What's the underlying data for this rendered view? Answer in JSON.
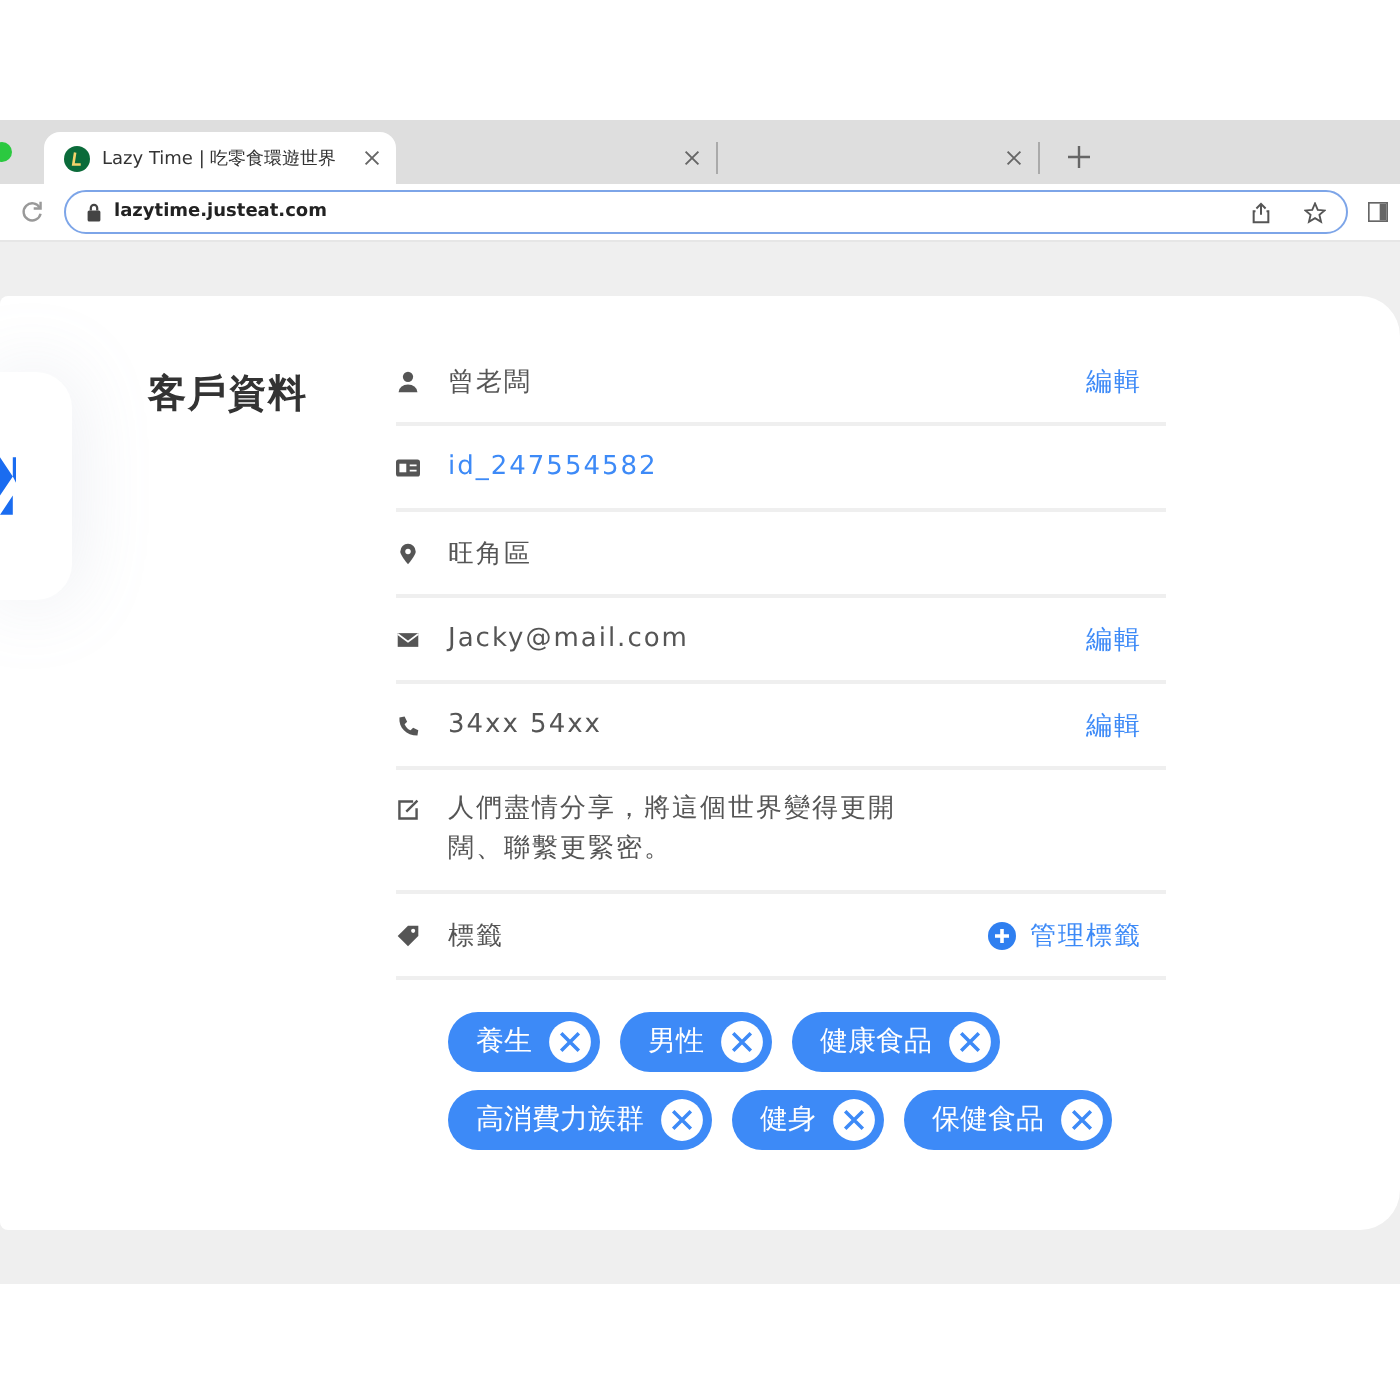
{
  "browser": {
    "tabs": [
      {
        "title": "Lazy Time | 吃零食環遊世界",
        "selected": true
      },
      {
        "selected": false
      },
      {
        "selected": false
      }
    ],
    "url": "lazytime.justeat.com"
  },
  "card": {
    "title": "客戶資料",
    "fields": [
      {
        "kind": "name",
        "value": "曾老闆",
        "action": "編輯"
      },
      {
        "kind": "id",
        "value": "id_247554582"
      },
      {
        "kind": "location",
        "value": "旺角區"
      },
      {
        "kind": "email",
        "value": "Jacky@mail.com",
        "action": "編輯"
      },
      {
        "kind": "phone",
        "value": "34xx 54xx",
        "action": "編輯"
      },
      {
        "kind": "note",
        "value": "人們盡情分享，將這個世界變得更開闊、聯繫更緊密。"
      },
      {
        "kind": "tags",
        "value": "標籤",
        "action": "管理標籤"
      }
    ],
    "tags": [
      "養生",
      "男性",
      "健康食品",
      "高消費力族群",
      "健身",
      "保健食品"
    ]
  }
}
